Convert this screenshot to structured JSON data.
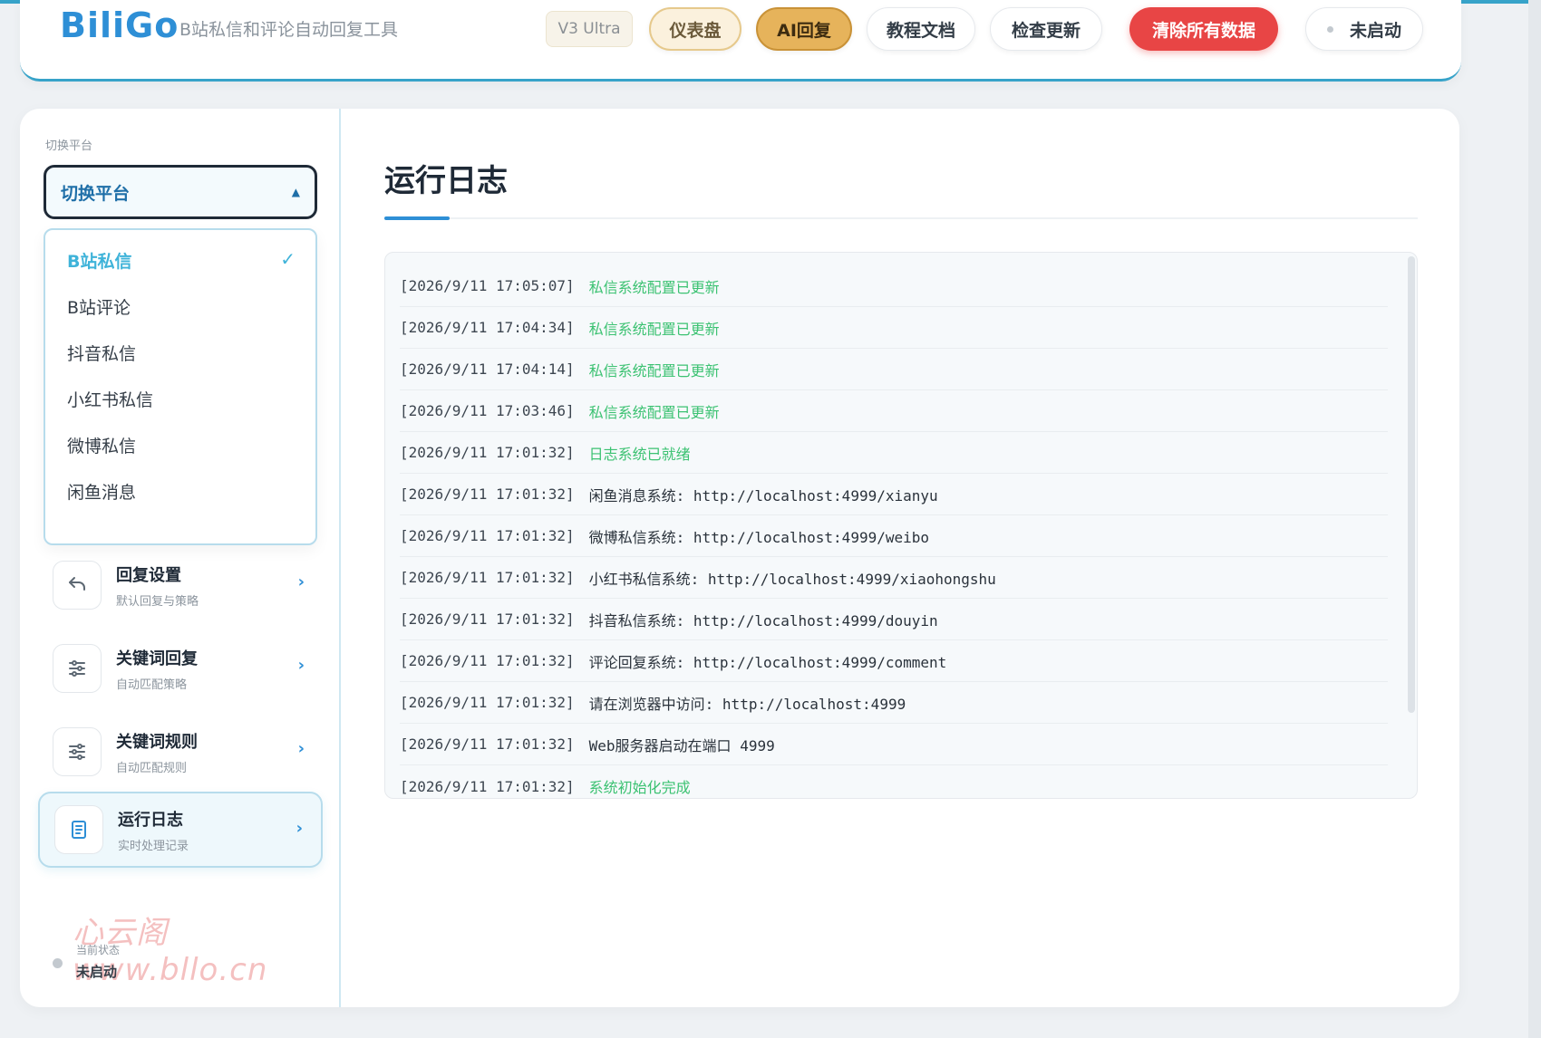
{
  "header": {
    "brand": "BiliGo",
    "subtitle": "B站私信和评论自动回复工具",
    "version": "V3 Ultra",
    "buttons": {
      "dashboard": "仪表盘",
      "ai_reply": "AI回复",
      "docs": "教程文档",
      "check_update": "检查更新",
      "clear_data": "清除所有数据"
    },
    "status": "未启动"
  },
  "sidebar": {
    "section_label": "切换平台",
    "select_label": "切换平台",
    "platforms": [
      {
        "label": "B站私信",
        "selected": true
      },
      {
        "label": "B站评论"
      },
      {
        "label": "抖音私信"
      },
      {
        "label": "小红书私信"
      },
      {
        "label": "微博私信"
      },
      {
        "label": "闲鱼消息"
      }
    ],
    "nav": [
      {
        "title": "回复设置",
        "sub": "默认回复与策略",
        "icon": "reply-icon"
      },
      {
        "title": "关键词回复",
        "sub": "自动匹配策略",
        "icon": "sliders-icon"
      },
      {
        "title": "关键词规则",
        "sub": "自动匹配规则",
        "icon": "sliders-icon"
      },
      {
        "title": "运行日志",
        "sub": "实时处理记录",
        "icon": "document-icon",
        "active": true
      }
    ],
    "watermark": "心云阁www.bllo.cn",
    "state_label": "当前状态",
    "state_value": "未启动"
  },
  "main": {
    "title": "运行日志",
    "logs": [
      {
        "time": "[2026/9/11 17:05:07]",
        "msg": "私信系统配置已更新",
        "highlight": true
      },
      {
        "time": "[2026/9/11 17:04:34]",
        "msg": "私信系统配置已更新",
        "highlight": true
      },
      {
        "time": "[2026/9/11 17:04:14]",
        "msg": "私信系统配置已更新",
        "highlight": true
      },
      {
        "time": "[2026/9/11 17:03:46]",
        "msg": "私信系统配置已更新",
        "highlight": true
      },
      {
        "time": "[2026/9/11 17:01:32]",
        "msg": "日志系统已就绪",
        "highlight": true
      },
      {
        "time": "[2026/9/11 17:01:32]",
        "msg": "闲鱼消息系统: http://localhost:4999/xianyu"
      },
      {
        "time": "[2026/9/11 17:01:32]",
        "msg": "微博私信系统: http://localhost:4999/weibo"
      },
      {
        "time": "[2026/9/11 17:01:32]",
        "msg": "小红书私信系统: http://localhost:4999/xiaohongshu"
      },
      {
        "time": "[2026/9/11 17:01:32]",
        "msg": "抖音私信系统: http://localhost:4999/douyin"
      },
      {
        "time": "[2026/9/11 17:01:32]",
        "msg": "评论回复系统: http://localhost:4999/comment"
      },
      {
        "time": "[2026/9/11 17:01:32]",
        "msg": "请在浏览器中访问: http://localhost:4999"
      },
      {
        "time": "[2026/9/11 17:01:32]",
        "msg": "Web服务器启动在端口 4999"
      },
      {
        "time": "[2026/9/11 17:01:32]",
        "msg": "系统初始化完成",
        "highlight": true
      }
    ]
  },
  "colors": {
    "accent": "#2e8fd6",
    "success": "#3cc272",
    "danger": "#e84545",
    "gold": "#e6b35b"
  }
}
